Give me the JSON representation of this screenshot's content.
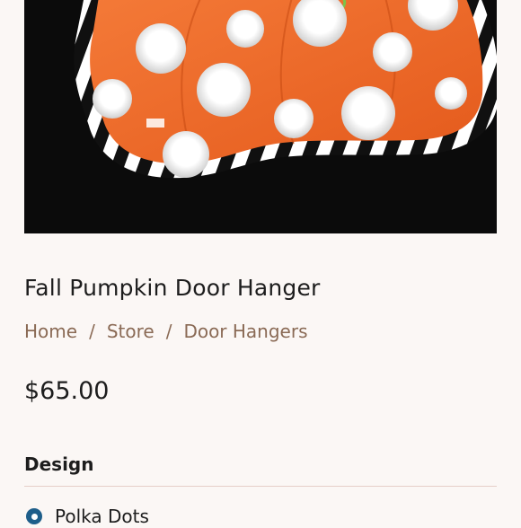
{
  "product": {
    "image_alt": "Orange pumpkin with white polka dots and black and white striped border",
    "title": "Fall Pumpkin Door Hanger",
    "price": "$65.00"
  },
  "breadcrumb": {
    "items": [
      "Home",
      "Store",
      "Door Hangers"
    ],
    "separator": "/"
  },
  "design": {
    "label": "Design",
    "selected_option": "Polka Dots"
  },
  "colors": {
    "accent": "#8a6a55",
    "radio": "#1e5e8a",
    "pumpkin": "#f06a2a",
    "background": "#fbf7f5"
  }
}
